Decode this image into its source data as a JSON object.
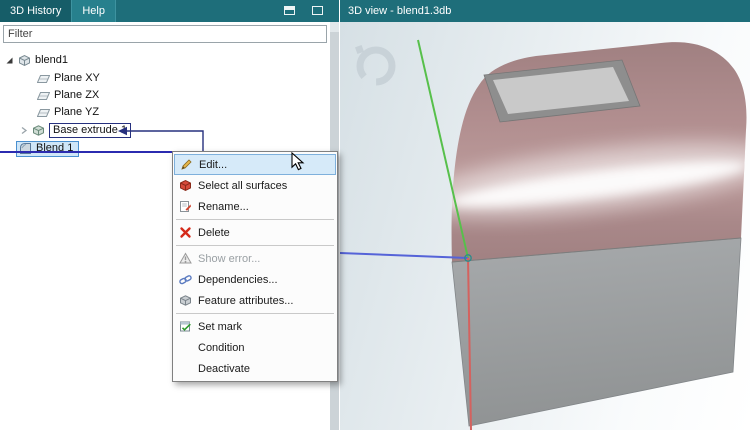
{
  "window": {
    "left_tabs": [
      {
        "label": "3D History"
      },
      {
        "label": "Help"
      }
    ],
    "right_title": "3D view - blend1.3db"
  },
  "filter": {
    "placeholder": "Filter"
  },
  "tree": {
    "root_label": "blend1",
    "children": [
      "Plane XY",
      "Plane ZX",
      "Plane YZ",
      "Base extrude 1",
      "Blend 1"
    ],
    "selected_item": "Blend 1"
  },
  "menu": {
    "items": [
      {
        "label": "Edit...",
        "icon": "pencil-icon",
        "state": "highlighted"
      },
      {
        "label": "Select all surfaces",
        "icon": "surfaces-cube-icon",
        "state": "normal"
      },
      {
        "label": "Rename...",
        "icon": "rename-icon",
        "state": "normal"
      },
      {
        "label": "Delete",
        "icon": "delete-x-icon",
        "state": "normal"
      },
      {
        "label": "Show error...",
        "icon": "warning-icon",
        "state": "disabled"
      },
      {
        "label": "Dependencies...",
        "icon": "chain-link-icon",
        "state": "normal"
      },
      {
        "label": "Feature attributes...",
        "icon": "attributes-icon",
        "state": "normal"
      },
      {
        "label": "Set mark",
        "icon": "set-mark-icon",
        "state": "normal"
      },
      {
        "label": "Condition",
        "icon": "",
        "state": "normal"
      },
      {
        "label": "Deactivate",
        "icon": "",
        "state": "normal"
      }
    ]
  },
  "colors": {
    "header_teal": "#1e6e7a",
    "selection_fill": "#cfe6f8",
    "selection_border": "#4a90d0",
    "menu_highlight": "#d6eaf9",
    "dependency_link_blue": "#26307e",
    "model_top_pink": "#b18e8f",
    "model_front_gray": "#9a9d9f",
    "axis_green": "#57c04b",
    "axis_blue": "#5563d8",
    "axis_red": "#d4625f"
  }
}
